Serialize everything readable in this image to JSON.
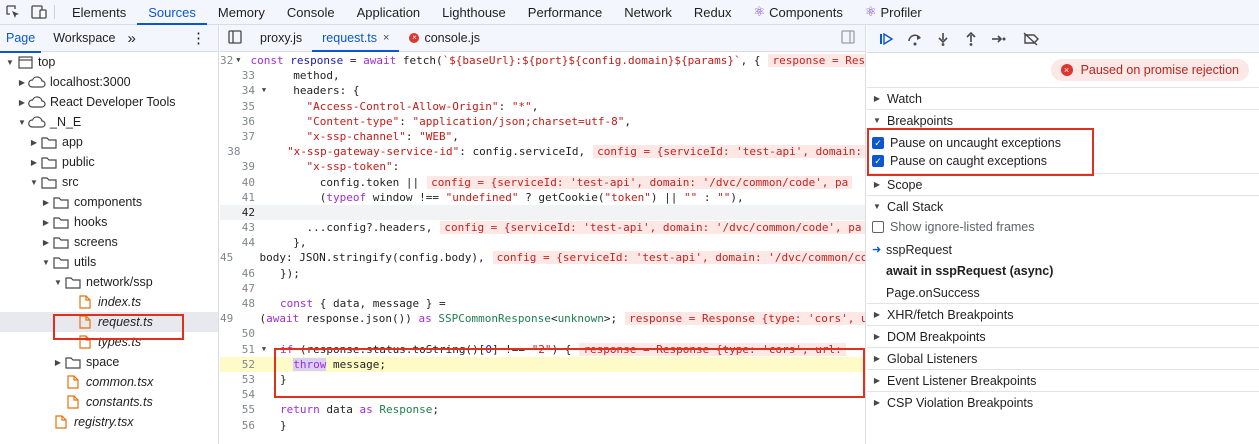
{
  "toolbar": {
    "icons": [
      "inspect-icon",
      "device-toggle-icon"
    ],
    "tabs": [
      "Elements",
      "Sources",
      "Memory",
      "Console",
      "Application",
      "Lighthouse",
      "Performance",
      "Network",
      "Redux",
      "Components",
      "Profiler"
    ],
    "active_tab": "Sources"
  },
  "navigator": {
    "tabs": [
      "Page",
      "Workspace"
    ],
    "more": "»",
    "menu": "⋮",
    "tree": [
      {
        "label": "top",
        "depth": 0,
        "kind": "frame",
        "open": true
      },
      {
        "label": "localhost:3000",
        "depth": 1,
        "kind": "cloud",
        "open": false
      },
      {
        "label": "React Developer Tools",
        "depth": 1,
        "kind": "cloud",
        "open": false
      },
      {
        "label": "_N_E",
        "depth": 1,
        "kind": "cloud",
        "open": true
      },
      {
        "label": "app",
        "depth": 2,
        "kind": "folder",
        "open": false
      },
      {
        "label": "public",
        "depth": 2,
        "kind": "folder",
        "open": false
      },
      {
        "label": "src",
        "depth": 2,
        "kind": "folder",
        "open": true
      },
      {
        "label": "components",
        "depth": 3,
        "kind": "folder",
        "open": false
      },
      {
        "label": "hooks",
        "depth": 3,
        "kind": "folder",
        "open": false
      },
      {
        "label": "screens",
        "depth": 3,
        "kind": "folder",
        "open": false
      },
      {
        "label": "utils",
        "depth": 3,
        "kind": "folder",
        "open": true
      },
      {
        "label": "network/ssp",
        "depth": 4,
        "kind": "folder",
        "open": true
      },
      {
        "label": "index.ts",
        "depth": 5,
        "kind": "file"
      },
      {
        "label": "request.ts",
        "depth": 5,
        "kind": "file",
        "selected": true
      },
      {
        "label": "types.ts",
        "depth": 5,
        "kind": "file"
      },
      {
        "label": "space",
        "depth": 4,
        "kind": "folder",
        "open": false
      },
      {
        "label": "common.tsx",
        "depth": 4,
        "kind": "file"
      },
      {
        "label": "constants.ts",
        "depth": 4,
        "kind": "file"
      },
      {
        "label": "registry.tsx",
        "depth": 3,
        "kind": "file"
      }
    ]
  },
  "editor": {
    "tabs": [
      {
        "label": "proxy.js",
        "active": false,
        "error": false
      },
      {
        "label": "request.ts",
        "active": true,
        "error": false,
        "close": "×"
      },
      {
        "label": "console.js",
        "active": false,
        "error": true
      }
    ],
    "lines": [
      {
        "n": "32",
        "fold": true,
        "html": "<span class='kw'>const</span> <span class='vr'>response</span> = <span class='kw'>await</span> fetch(<span class='str'>`${baseUrl}:${port}${config.domain}${params}`</span>, {<span class='inl'>response = Response {type: 'cors', url:</span>"
      },
      {
        "n": "33",
        "html": "  method,"
      },
      {
        "n": "34",
        "fold": true,
        "html": "  headers: {"
      },
      {
        "n": "35",
        "html": "    <span class='str'>\"Access-Control-Allow-Origin\"</span>: <span class='str'>\"*\"</span>,"
      },
      {
        "n": "36",
        "html": "    <span class='str'>\"Content-type\"</span>: <span class='str'>\"application/json;charset=utf-8\"</span>,"
      },
      {
        "n": "37",
        "html": "    <span class='str'>\"x-ssp-channel\"</span>: <span class='str'>\"WEB\"</span>,"
      },
      {
        "n": "38",
        "html": "    <span class='str'>\"x-ssp-gateway-service-id\"</span>: config.serviceId,<span class='inl'>config = {serviceId: 'test-api', domain:</span>"
      },
      {
        "n": "39",
        "html": "    <span class='str'>\"x-ssp-token\"</span>:"
      },
      {
        "n": "40",
        "html": "      config.token ||<span class='inl'>config = {serviceId: 'test-api', domain: '/dvc/common/code', pa</span>"
      },
      {
        "n": "41",
        "html": "      (<span class='kw'>typeof</span> window !== <span class='str'>\"undefined\"</span> ? getCookie(<span class='str'>\"token\"</span>) || <span class='str'>\"\"</span> : <span class='str'>\"\"</span>),"
      },
      {
        "n": "42",
        "html": "",
        "cur": true
      },
      {
        "n": "43",
        "html": "    ...config?.headers,<span class='inl'>config = {serviceId: 'test-api', domain: '/dvc/common/code', pa</span>"
      },
      {
        "n": "44",
        "html": "  },"
      },
      {
        "n": "45",
        "html": "  body: JSON.stringify(config.body),<span class='inl'>config = {serviceId: 'test-api', domain: '/dvc/common/code'</span>"
      },
      {
        "n": "46",
        "html": "});"
      },
      {
        "n": "47",
        "html": ""
      },
      {
        "n": "48",
        "html": "<span class='kw'>const</span> { data, message } ="
      },
      {
        "n": "49",
        "html": "  (<span class='kw'>await</span> response.json()) <span class='kw'>as</span> <span class='ty'>SSPCommonResponse</span>&lt;<span class='ty'>unknown</span>&gt;;<span class='inl'>response = Response {type: 'cors', url:</span>"
      },
      {
        "n": "50",
        "html": ""
      },
      {
        "n": "51",
        "fold": true,
        "html": "<span class='kw'>if</span> (response.status.toString()[<span class='vr'>0</span>] !== <span class='str'>\"2\"</span>) {<span class='inl'>response = Response {type: 'cors', url:</span>"
      },
      {
        "n": "52",
        "hl": true,
        "html": "  <span class='kw' style='background:#d9d0f5'>throw</span> message;"
      },
      {
        "n": "53",
        "html": "}"
      },
      {
        "n": "54",
        "html": ""
      },
      {
        "n": "55",
        "html": "<span class='kw'>return</span> data <span class='kw'>as</span> <span class='ty'>Response</span>;"
      },
      {
        "n": "56",
        "html": "}"
      }
    ]
  },
  "debugger": {
    "paused_text": "Paused on promise rejection",
    "watch": "Watch",
    "breakpoints": "Breakpoints",
    "pause_uncaught": "Pause on uncaught exceptions",
    "pause_caught": "Pause on caught exceptions",
    "scope": "Scope",
    "call_stack": "Call Stack",
    "show_ignore": "Show ignore-listed frames",
    "frames": [
      "sspRequest",
      "await in sspRequest (async)",
      "Page.onSuccess"
    ],
    "sections": [
      "XHR/fetch Breakpoints",
      "DOM Breakpoints",
      "Global Listeners",
      "Event Listener Breakpoints",
      "CSP Violation Breakpoints"
    ]
  },
  "colors": {
    "accent": "#0b57d0",
    "error": "#dc362e",
    "highlight": "#e0301e"
  }
}
